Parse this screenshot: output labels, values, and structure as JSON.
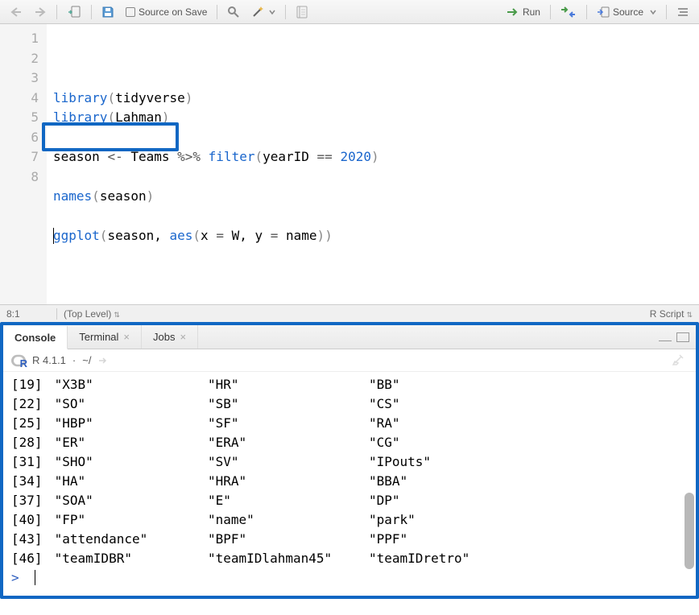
{
  "toolbar": {
    "source_on_save_label": "Source on Save",
    "run_label": "Run",
    "source_btn_label": "Source"
  },
  "editor": {
    "lines": [
      {
        "n": "1",
        "tokens": [
          {
            "t": "library",
            "c": "tok-fn"
          },
          {
            "t": "(",
            "c": "tok-par"
          },
          {
            "t": "tidyverse",
            "c": "tok-id"
          },
          {
            "t": ")",
            "c": "tok-par"
          }
        ]
      },
      {
        "n": "2",
        "tokens": [
          {
            "t": "library",
            "c": "tok-fn"
          },
          {
            "t": "(",
            "c": "tok-par"
          },
          {
            "t": "Lahman",
            "c": "tok-id"
          },
          {
            "t": ")",
            "c": "tok-par"
          }
        ]
      },
      {
        "n": "3",
        "tokens": []
      },
      {
        "n": "4",
        "tokens": [
          {
            "t": "season ",
            "c": "tok-id"
          },
          {
            "t": "<- ",
            "c": "tok-op"
          },
          {
            "t": "Teams ",
            "c": "tok-id"
          },
          {
            "t": "%>% ",
            "c": "tok-op"
          },
          {
            "t": "filter",
            "c": "tok-fn"
          },
          {
            "t": "(",
            "c": "tok-par"
          },
          {
            "t": "yearID ",
            "c": "tok-id"
          },
          {
            "t": "== ",
            "c": "tok-op"
          },
          {
            "t": "2020",
            "c": "tok-num"
          },
          {
            "t": ")",
            "c": "tok-par"
          }
        ]
      },
      {
        "n": "5",
        "tokens": []
      },
      {
        "n": "6",
        "tokens": [
          {
            "t": "names",
            "c": "tok-fn"
          },
          {
            "t": "(",
            "c": "tok-par"
          },
          {
            "t": "season",
            "c": "tok-id"
          },
          {
            "t": ")",
            "c": "tok-par"
          }
        ]
      },
      {
        "n": "7",
        "tokens": []
      },
      {
        "n": "8",
        "tokens": [
          {
            "t": "ggplot",
            "c": "tok-fn"
          },
          {
            "t": "(",
            "c": "tok-par"
          },
          {
            "t": "season, ",
            "c": "tok-id"
          },
          {
            "t": "aes",
            "c": "tok-fn"
          },
          {
            "t": "(",
            "c": "tok-par"
          },
          {
            "t": "x ",
            "c": "tok-id"
          },
          {
            "t": "= ",
            "c": "tok-op"
          },
          {
            "t": "W, y ",
            "c": "tok-id"
          },
          {
            "t": "= ",
            "c": "tok-op"
          },
          {
            "t": "name",
            "c": "tok-id"
          },
          {
            "t": ")",
            "c": "tok-par"
          },
          {
            "t": ")",
            "c": "tok-par"
          }
        ]
      }
    ]
  },
  "status": {
    "pos": "8:1",
    "scope": "(Top Level)",
    "lang": "R Script"
  },
  "tabs": {
    "console": "Console",
    "terminal": "Terminal",
    "jobs": "Jobs"
  },
  "console_head": {
    "version": "R 4.1.1",
    "sep": "·",
    "path": "~/"
  },
  "console": {
    "rows": [
      {
        "idx": "[19]",
        "c1": "\"X3B\"",
        "c2": "\"HR\"",
        "c3": "\"BB\""
      },
      {
        "idx": "[22]",
        "c1": "\"SO\"",
        "c2": "\"SB\"",
        "c3": "\"CS\""
      },
      {
        "idx": "[25]",
        "c1": "\"HBP\"",
        "c2": "\"SF\"",
        "c3": "\"RA\""
      },
      {
        "idx": "[28]",
        "c1": "\"ER\"",
        "c2": "\"ERA\"",
        "c3": "\"CG\""
      },
      {
        "idx": "[31]",
        "c1": "\"SHO\"",
        "c2": "\"SV\"",
        "c3": "\"IPouts\""
      },
      {
        "idx": "[34]",
        "c1": "\"HA\"",
        "c2": "\"HRA\"",
        "c3": "\"BBA\""
      },
      {
        "idx": "[37]",
        "c1": "\"SOA\"",
        "c2": "\"E\"",
        "c3": "\"DP\""
      },
      {
        "idx": "[40]",
        "c1": "\"FP\"",
        "c2": "\"name\"",
        "c3": "\"park\""
      },
      {
        "idx": "[43]",
        "c1": "\"attendance\"",
        "c2": "\"BPF\"",
        "c3": "\"PPF\""
      },
      {
        "idx": "[46]",
        "c1": "\"teamIDBR\"",
        "c2": "\"teamIDlahman45\"",
        "c3": "\"teamIDretro\""
      }
    ],
    "prompt": ">"
  }
}
